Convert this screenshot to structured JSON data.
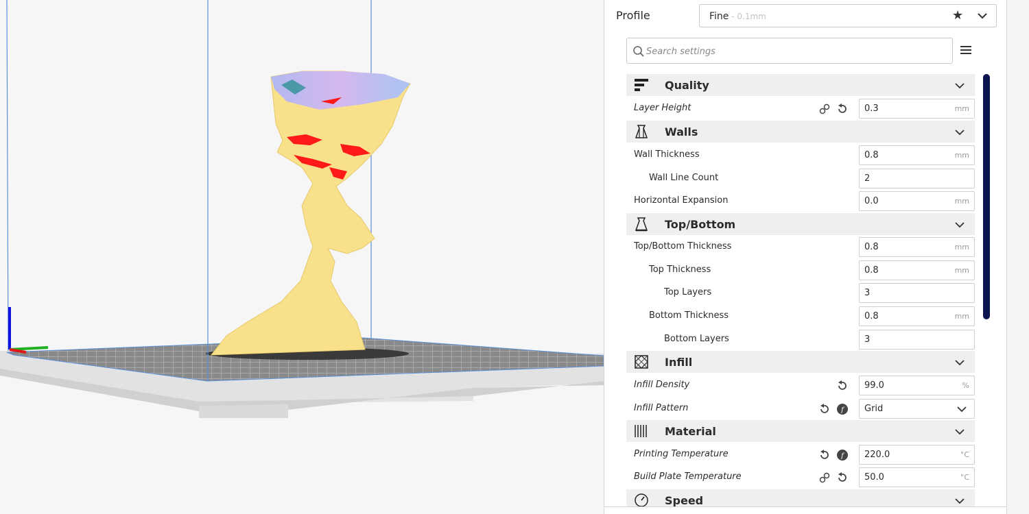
{
  "profile": {
    "label": "Profile",
    "name": "Fine",
    "sub": " - 0.1mm"
  },
  "search": {
    "placeholder": "Search settings"
  },
  "categories": {
    "quality": "Quality",
    "walls": "Walls",
    "topbottom": "Top/Bottom",
    "infill": "Infill",
    "material": "Material",
    "speed": "Speed"
  },
  "settings": {
    "layer_height": {
      "label": "Layer Height",
      "value": "0.3",
      "unit": "mm"
    },
    "wall_thickness": {
      "label": "Wall Thickness",
      "value": "0.8",
      "unit": "mm"
    },
    "wall_line_count": {
      "label": "Wall Line Count",
      "value": "2"
    },
    "horizontal_expansion": {
      "label": "Horizontal Expansion",
      "value": "0.0",
      "unit": "mm"
    },
    "topbottom_thickness": {
      "label": "Top/Bottom Thickness",
      "value": "0.8",
      "unit": "mm"
    },
    "top_thickness": {
      "label": "Top Thickness",
      "value": "0.8",
      "unit": "mm"
    },
    "top_layers": {
      "label": "Top Layers",
      "value": "3"
    },
    "bottom_thickness": {
      "label": "Bottom Thickness",
      "value": "0.8",
      "unit": "mm"
    },
    "bottom_layers": {
      "label": "Bottom Layers",
      "value": "3"
    },
    "infill_density": {
      "label": "Infill Density",
      "value": "99.0",
      "unit": "%"
    },
    "infill_pattern": {
      "label": "Infill Pattern",
      "value": "Grid"
    },
    "printing_temperature": {
      "label": "Printing Temperature",
      "value": "220.0",
      "unit": "°C"
    },
    "build_plate_temperature": {
      "label": "Build Plate Temperature",
      "value": "50.0",
      "unit": "°C"
    }
  },
  "colors": {
    "model": "#f9e18c",
    "overhang": "#ff1a1a",
    "scrollbar": "#0c1450",
    "build_volume_line": "#5b8fd8"
  }
}
